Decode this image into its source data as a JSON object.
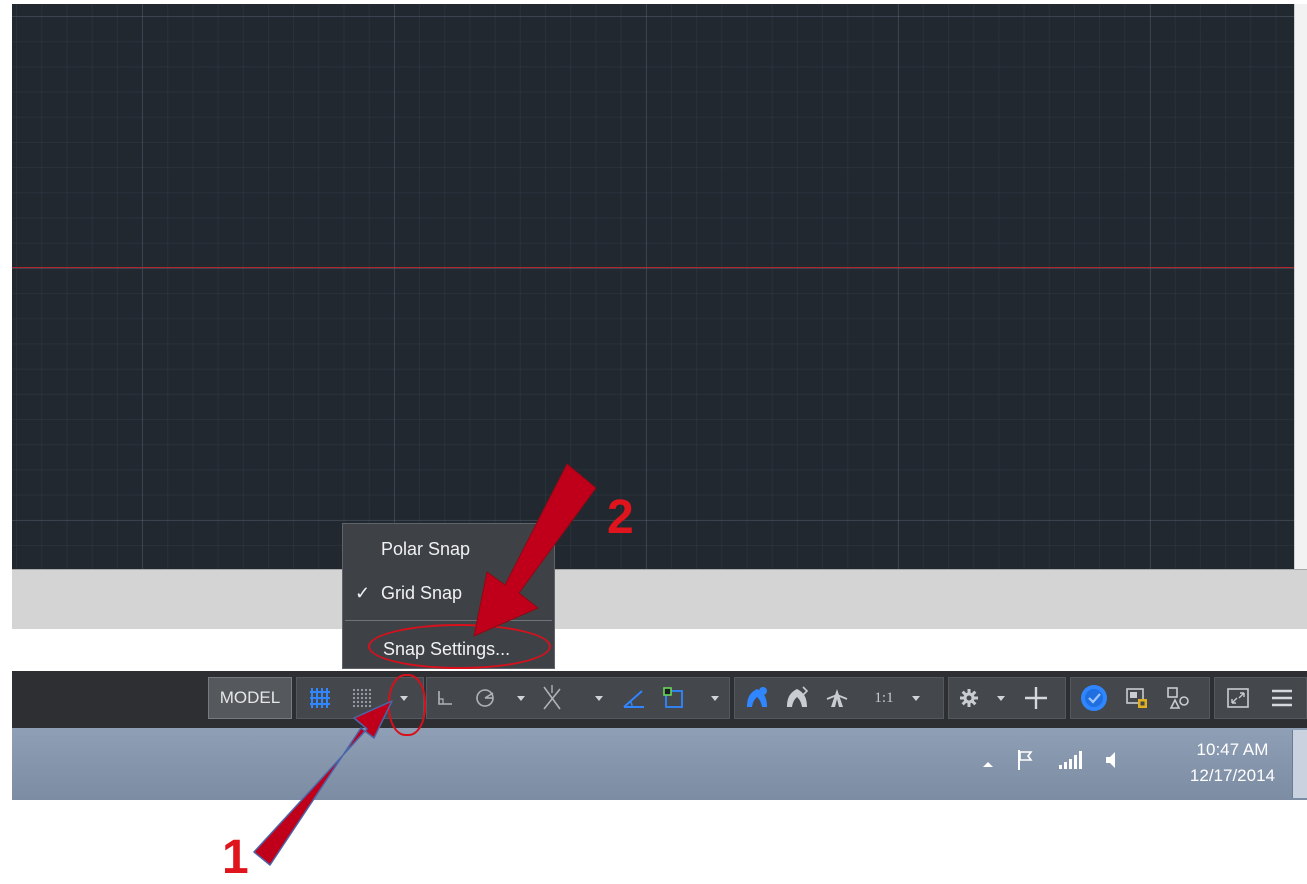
{
  "menu": {
    "items": [
      "Polar Snap",
      "Grid Snap",
      "Snap Settings..."
    ],
    "checked": "Grid Snap",
    "check_glyph": "✓"
  },
  "statusbar": {
    "model_label": "MODEL",
    "scale_label": "1:1",
    "icons": [
      "grid-display-icon",
      "snap-mode-icon",
      "ortho-icon",
      "polar-tracking-icon",
      "isodraft-icon",
      "object-snap-tracking-icon",
      "object-snap-icon",
      "annotation-visibility-icon",
      "autoscale-icon",
      "annotation-scale-icon",
      "workspace-gear-icon",
      "annotation-monitor-icon",
      "units-icon",
      "isolate-objects-icon",
      "graphics-performance-icon",
      "fullscreen-icon",
      "customization-icon"
    ]
  },
  "taskbar": {
    "time": "10:47 AM",
    "date": "12/17/2014"
  },
  "annotations": {
    "callout_1": "1",
    "callout_2": "2",
    "color": "#e0141c",
    "arrow_color": "#c0001a"
  },
  "colors": {
    "canvas": "#212830",
    "x_axis": "#b0262a",
    "statusbar": "#2d2f33",
    "active_blue": "#2f86ff"
  }
}
